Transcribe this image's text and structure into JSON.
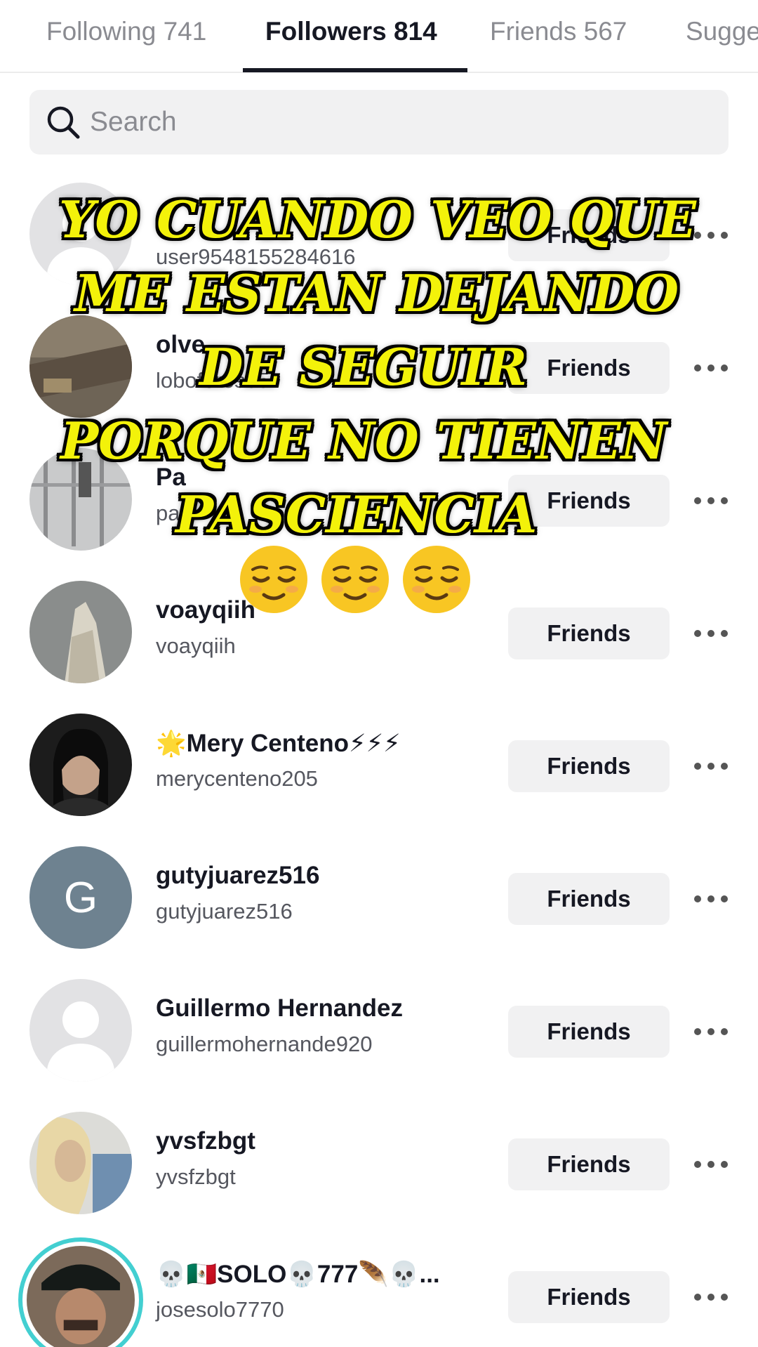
{
  "tabs": [
    {
      "label": "Following 741"
    },
    {
      "label": "Followers 814"
    },
    {
      "label": "Friends 567"
    },
    {
      "label": "Sugge"
    }
  ],
  "search": {
    "placeholder": "Search"
  },
  "rows": [
    {
      "name": "",
      "handle": "user9548155284616",
      "button": "Friends"
    },
    {
      "name": "olve",
      "handle": "loboferos85",
      "button": "Friends"
    },
    {
      "name": "Pa",
      "handle": "pa",
      "button": "Friends"
    },
    {
      "name": "voayqiih",
      "handle": "voayqiih",
      "button": "Friends"
    },
    {
      "name": "🌟Mery Centeno⚡⚡⚡",
      "handle": "merycenteno205",
      "button": "Friends"
    },
    {
      "name": "gutyjuarez516",
      "handle": "gutyjuarez516",
      "button": "Friends",
      "avatar_letter": "G"
    },
    {
      "name": "Guillermo Hernandez",
      "handle": "guillermohernande920",
      "button": "Friends"
    },
    {
      "name": "yvsfzbgt",
      "handle": "yvsfzbgt",
      "button": "Friends"
    },
    {
      "name": "💀🇲🇽SOLO💀777🪶💀...",
      "handle": "josesolo7770",
      "button": "Friends"
    }
  ],
  "caption": {
    "lines": [
      "YO CUANDO VEO QUE",
      "ME ESTAN DEJANDO",
      "DE SEGUIR",
      "PORQUE NO TIENEN",
      "PASCIENCIA"
    ],
    "emoji": "relieved-face-emoji"
  },
  "colors": {
    "caption_fill": "#f3f20a",
    "caption_outline": "#000000",
    "button_bg": "#f1f1f2",
    "active_tab": "#161823",
    "inactive_tab": "#8a8b91"
  }
}
